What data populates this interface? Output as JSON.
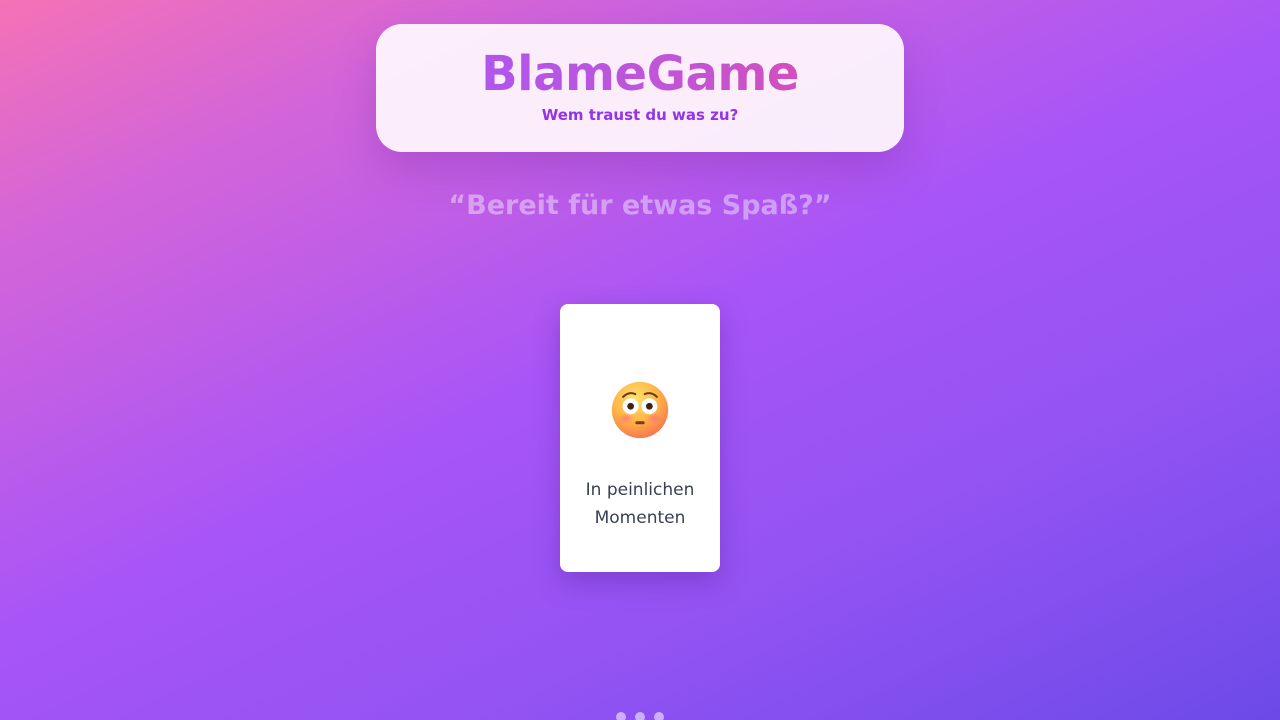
{
  "header": {
    "title": "BlameGame",
    "subtitle": "Wem traust du was zu?"
  },
  "tagline": "“Bereit für etwas Spaß?”",
  "card": {
    "emoji_icon": "flushed-face-icon",
    "label": "In peinlichen Momenten"
  },
  "loading": {
    "dot_count": 3
  },
  "colors": {
    "title_gradient_start": "#a855f7",
    "title_gradient_end": "#e04aa8",
    "subtitle": "#9333ea",
    "background_start": "#f472b6",
    "background_mid": "#a855f7",
    "background_end": "#6c4ae8",
    "card_text": "#374151"
  }
}
